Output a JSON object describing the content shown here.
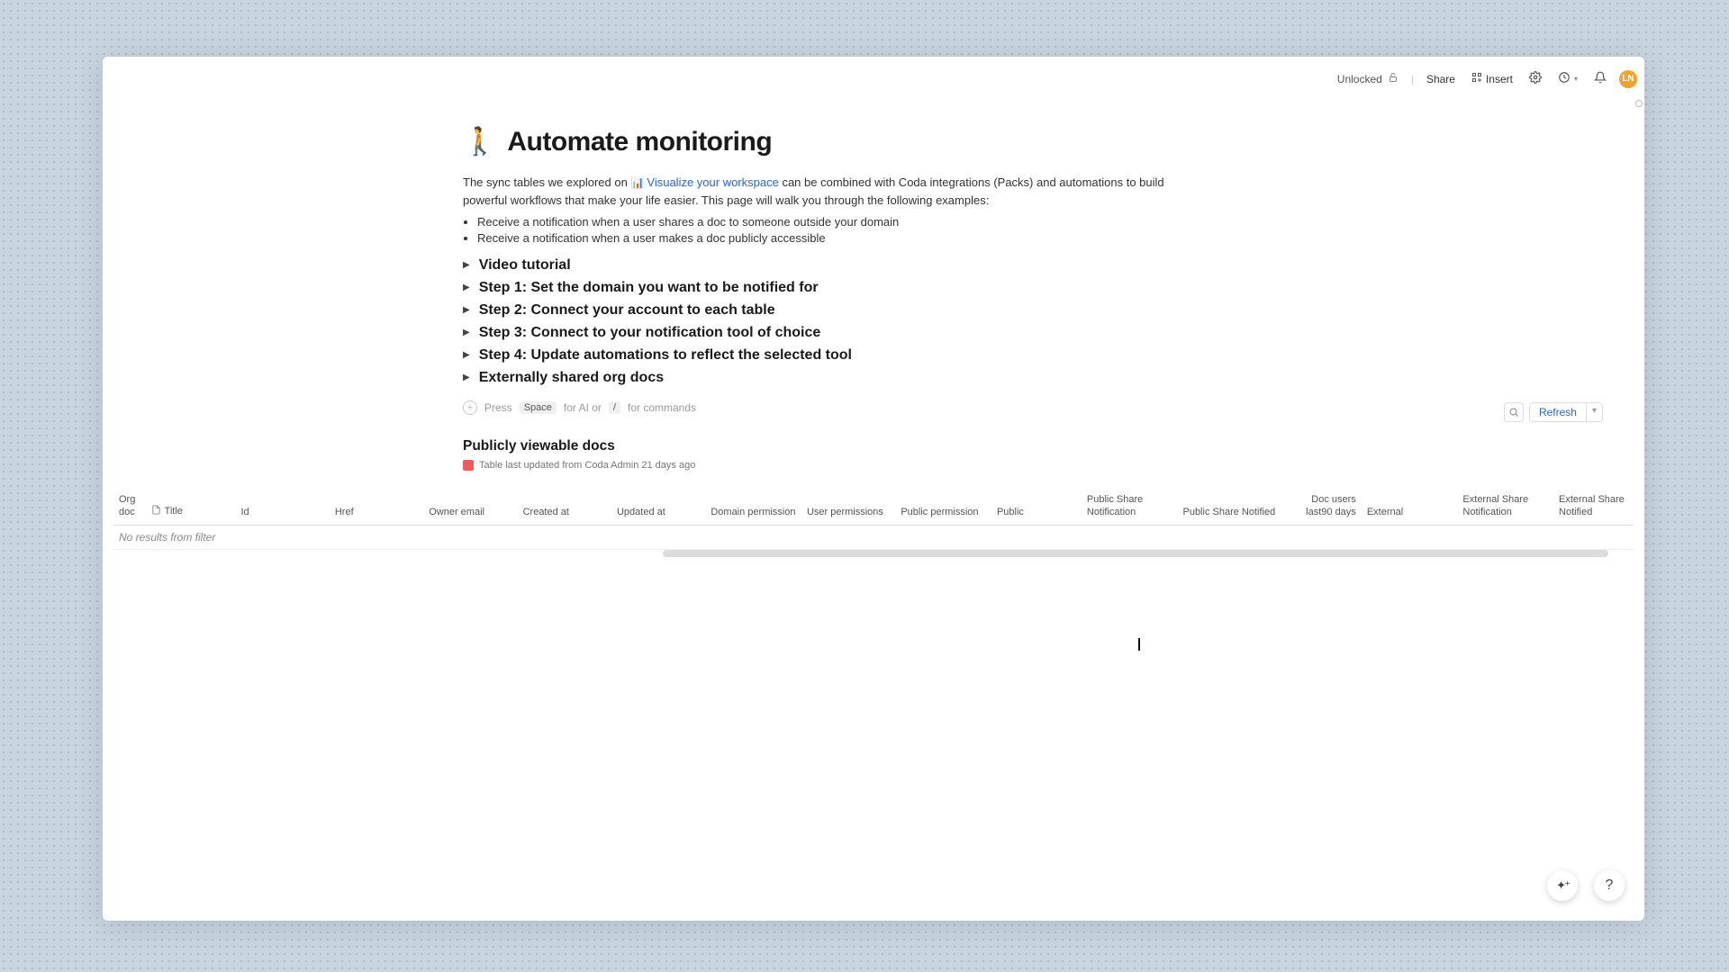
{
  "topbar": {
    "unlocked": "Unlocked",
    "share": "Share",
    "insert": "Insert",
    "avatar": "LN"
  },
  "page": {
    "emoji": "🚶",
    "title": "Automate monitoring",
    "intro_pre": "The sync tables we explored on ",
    "intro_link_emoji": "📊",
    "intro_link": "Visualize your workspace",
    "intro_post": " can be combined with Coda integrations (Packs) and automations to build powerful workflows that make your life easier. This page will walk you through the following examples:",
    "bullets": [
      "Receive a notification when a user shares a doc to someone outside your domain",
      "Receive a notification when a user makes a doc publicly accessible"
    ]
  },
  "toggles": [
    "Video tutorial",
    "Step 1: Set the domain you want to be notified for",
    "Step 2: Connect your account to each table",
    "Step 3: Connect to your notification tool of choice",
    "Step 4: Update automations to reflect the selected tool",
    "Externally shared org docs"
  ],
  "placeholder": {
    "press": "Press",
    "space_key": "Space",
    "for_ai_or": "for AI or",
    "slash_key": "/",
    "for_commands": "for commands"
  },
  "section": {
    "title": "Publicly viewable docs",
    "meta": "Table last updated from Coda Admin 21 days ago",
    "refresh": "Refresh"
  },
  "table": {
    "columns": [
      "Org doc",
      "Title",
      "Id",
      "Href",
      "Owner email",
      "Created at",
      "Updated at",
      "Domain permission",
      "User permissions",
      "Public permission",
      "Public",
      "Public Share Notification",
      "Public Share Notified",
      "Doc users last90 days",
      "External",
      "External Share Notification",
      "External Share Notified"
    ],
    "empty": "No results from filter"
  }
}
